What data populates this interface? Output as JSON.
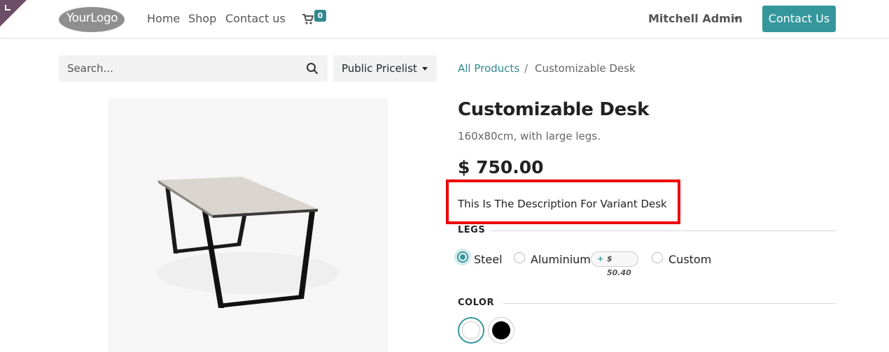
{
  "header": {
    "logo_text": "YourLogo",
    "nav": {
      "home": "Home",
      "shop": "Shop",
      "contact": "Contact us"
    },
    "cart_count": "0",
    "user_name": "Mitchell Admin",
    "contact_button": "Contact Us",
    "accent_color": "#35979c"
  },
  "search": {
    "placeholder": "Search...",
    "pricelist": "Public Pricelist"
  },
  "breadcrumb": {
    "parent": "All Products",
    "separator": "/",
    "current": "Customizable Desk"
  },
  "product": {
    "name": "Customizable Desk",
    "subtitle": "160x80cm, with large legs.",
    "price": "$ 750.00",
    "variant_description": "This Is The Description For Variant Desk",
    "highlight_color": "#ee0000"
  },
  "attributes": {
    "legs": {
      "label": "LEGS",
      "options": [
        {
          "label": "Steel",
          "selected": true
        },
        {
          "label": "Aluminium",
          "selected": false,
          "extra_sign": "+",
          "extra_price": "$ 50.40"
        },
        {
          "label": "Custom",
          "selected": false
        }
      ]
    },
    "color": {
      "label": "COLOR",
      "swatches": [
        {
          "name": "white",
          "hex": "#ffffff",
          "selected": true
        },
        {
          "name": "black",
          "hex": "#000000",
          "selected": false
        }
      ]
    }
  },
  "icons": {
    "cart": "shopping-cart-icon",
    "search": "magnifier-icon",
    "corner": "edit-corner-icon"
  }
}
